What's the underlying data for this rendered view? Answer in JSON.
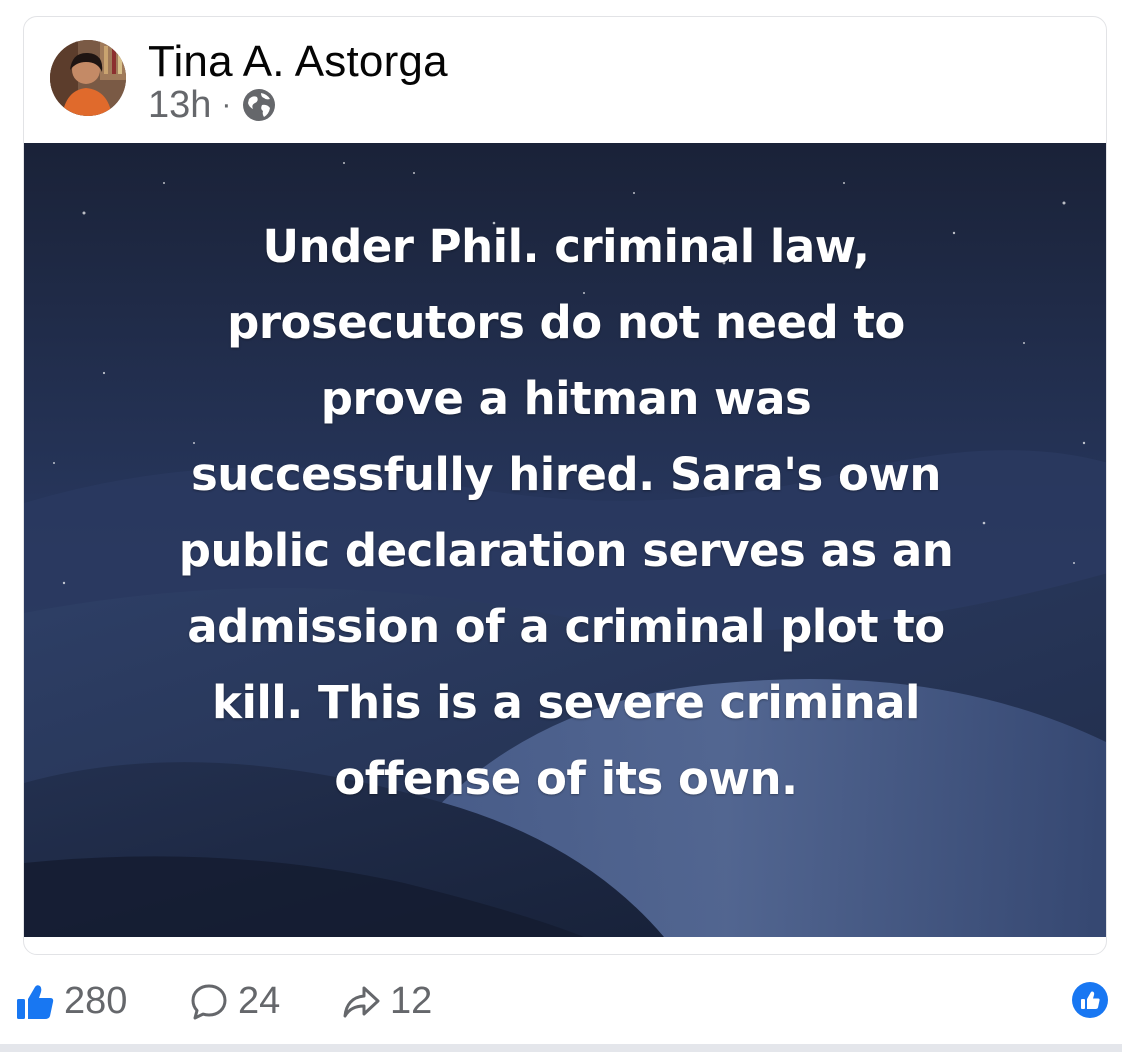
{
  "post": {
    "author_name": "Tina A. Astorga",
    "timestamp": "13h",
    "separator": "·",
    "privacy_icon": "globe-icon",
    "text": "Under Phil. criminal law,\nprosecutors do not need to\nprove a hitman was\nsuccessfully hired. Sara's own\npublic declaration serves as an\nadmission of a criminal plot to\nkill. This is a severe criminal\noffense of its own."
  },
  "actions": {
    "likes": "280",
    "comments": "24",
    "shares": "12",
    "like_icon": "thumbs-up-icon",
    "comment_icon": "comment-bubble-icon",
    "share_icon": "share-arrow-icon"
  },
  "colors": {
    "accent": "#1877f2",
    "secondary_text": "#65676b",
    "image_background": "#1c2740"
  }
}
